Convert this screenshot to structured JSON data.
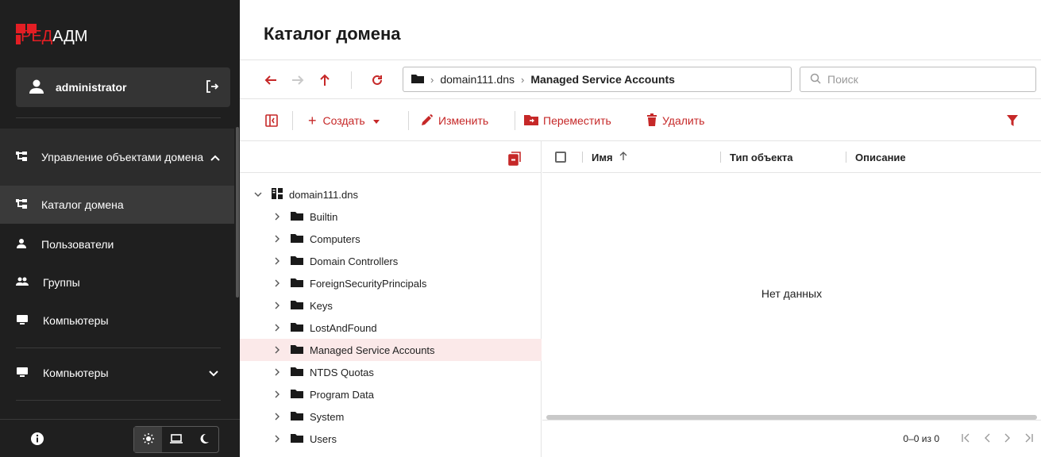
{
  "app": {
    "logo_red": "РЕД",
    "logo_white": "АДМ"
  },
  "user": {
    "name": "administrator"
  },
  "sidebar": {
    "group_label": "Управление объектами домена",
    "items": [
      {
        "label": "Каталог домена",
        "icon": "tree-icon"
      },
      {
        "label": "Пользователи",
        "icon": "user-icon"
      },
      {
        "label": "Группы",
        "icon": "group-icon"
      },
      {
        "label": "Компьютеры",
        "icon": "monitor-icon"
      }
    ],
    "section2_label": "Компьютеры"
  },
  "page": {
    "title": "Каталог домена"
  },
  "breadcrumb": {
    "domain": "domain111.dns",
    "current": "Managed Service Accounts"
  },
  "search": {
    "placeholder": "Поиск"
  },
  "toolbar": {
    "create": "Создать",
    "edit": "Изменить",
    "move": "Переместить",
    "delete": "Удалить"
  },
  "tree": {
    "root": "domain111.dns",
    "children": [
      "Builtin",
      "Computers",
      "Domain Controllers",
      "ForeignSecurityPrincipals",
      "Keys",
      "LostAndFound",
      "Managed Service Accounts",
      "NTDS Quotas",
      "Program Data",
      "System",
      "Users"
    ],
    "selected": "Managed Service Accounts"
  },
  "table": {
    "columns": [
      "Имя",
      "Тип объекта",
      "Описание"
    ],
    "empty_text": "Нет данных",
    "pagination": "0–0 из 0"
  },
  "colors": {
    "accent": "#c62828",
    "sidebar_bg": "#1f1f1f",
    "logo_red": "#e31e24"
  }
}
